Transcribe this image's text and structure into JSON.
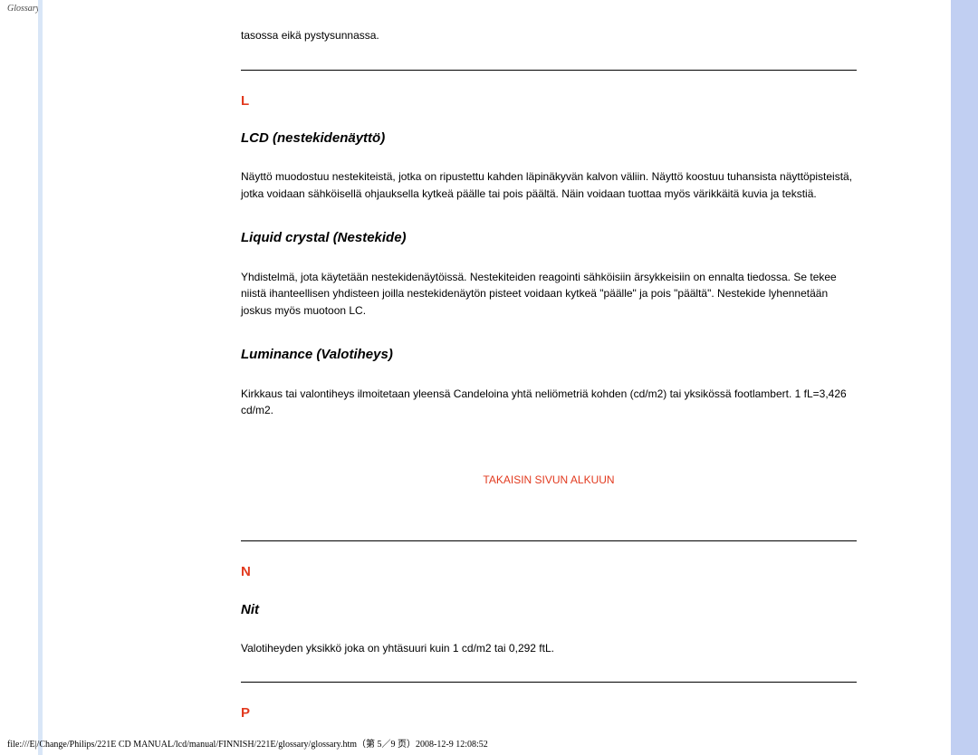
{
  "page_header": "Glossary",
  "intro_fragment": "tasossa eikä pystysunnassa.",
  "section_L": {
    "letter": "L",
    "terms": [
      {
        "title": "LCD (nestekidenäyttö)",
        "definition": "Näyttö muodostuu nestekiteistä, jotka on ripustettu kahden läpinäkyvän kalvon väliin. Näyttö koostuu tuhansista näyttöpisteistä, jotka voidaan sähköisellä ohjauksella kytkeä päälle tai pois päältä. Näin voidaan tuottaa myös värikkäitä kuvia ja tekstiä."
      },
      {
        "title": "Liquid crystal (Nestekide)",
        "definition": "Yhdistelmä, jota käytetään nestekidenäytöissä. Nestekiteiden reagointi sähköisiin ärsykkeisiin on ennalta tiedossa. Se tekee niistä ihanteellisen yhdisteen joilla nestekidenäytön pisteet voidaan kytkeä \"päälle\" ja pois \"päältä\". Nestekide lyhennetään joskus myös muotoon LC."
      },
      {
        "title": "Luminance (Valotiheys)",
        "definition": "Kirkkaus tai valontiheys ilmoitetaan yleensä Candeloina yhtä neliömetriä kohden (cd/m2) tai yksikössä footlambert. 1 fL=3,426 cd/m2."
      }
    ]
  },
  "back_to_top": "TAKAISIN SIVUN ALKUUN",
  "section_N": {
    "letter": "N",
    "terms": [
      {
        "title": "Nit",
        "definition": "Valotiheyden yksikkö joka on yhtäsuuri kuin 1 cd/m2 tai 0,292 ftL."
      }
    ]
  },
  "section_P": {
    "letter": "P"
  },
  "footer": "file:///E|/Change/Philips/221E CD MANUAL/lcd/manual/FINNISH/221E/glossary/glossary.htm（第 5／9 页）2008-12-9 12:08:52"
}
